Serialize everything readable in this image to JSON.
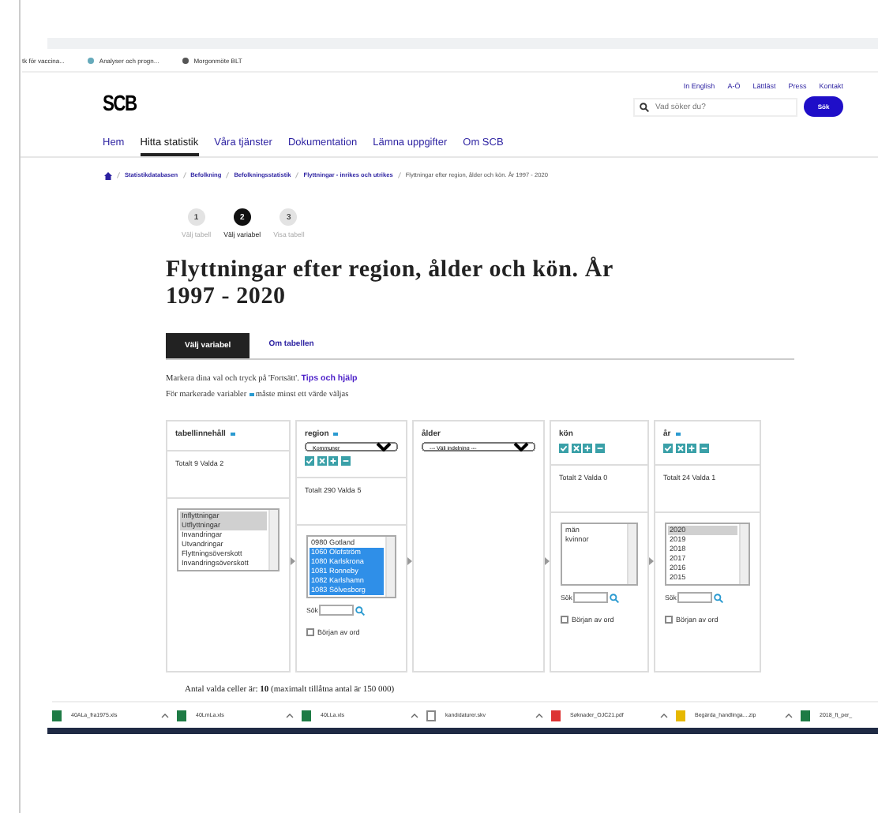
{
  "bookmarks": [
    "tk för vaccina...",
    "Analyser och progn...",
    "Morgonmöte BLT"
  ],
  "header": {
    "logo": "SCB",
    "top_links": [
      "In English",
      "A-Ö",
      "Lättläst",
      "Press",
      "Kontakt"
    ],
    "search": {
      "placeholder": "Vad söker du?"
    },
    "search_button": "Sök"
  },
  "nav": [
    {
      "label": "Hem",
      "selected": false
    },
    {
      "label": "Hitta statistik",
      "selected": true
    },
    {
      "label": "Våra tjänster",
      "selected": false
    },
    {
      "label": "Dokumentation",
      "selected": false
    },
    {
      "label": "Lämna uppgifter",
      "selected": false
    },
    {
      "label": "Om SCB",
      "selected": false
    }
  ],
  "breadcrumb": [
    "Statistikdatabasen",
    "Befolkning",
    "Befolkningsstatistik",
    "Flyttningar - inrikes och utrikes",
    "Flyttningar efter region, ålder och kön. År 1997 - 2020"
  ],
  "steps": [
    {
      "number": "1",
      "label": "Välj tabell",
      "selected": false
    },
    {
      "number": "2",
      "label": "Välj variabel",
      "selected": true
    },
    {
      "number": "3",
      "label": "Visa tabell",
      "selected": false
    }
  ],
  "title": "Flyttningar efter region, ålder och kön. År 1997 - 2020",
  "tabs": [
    {
      "label": "Välj variabel",
      "selected": true
    },
    {
      "label": "Om tabellen",
      "selected": false
    }
  ],
  "instructions": {
    "text": "Markera dina val och tryck på 'Fortsätt'.",
    "link": "Tips och hjälp",
    "note": "För markerade variabler",
    "note_end": "måste minst ett värde väljas"
  },
  "variables": [
    {
      "name": "tabellinnehåll",
      "mandatory": true,
      "totals": "Totalt 9 Valda 2",
      "items": [
        {
          "label": "Inflyttningar",
          "selected": true
        },
        {
          "label": "Utflyttningar",
          "selected": true
        },
        {
          "label": "Invandringar",
          "selected": false
        },
        {
          "label": "Utvandringar",
          "selected": false
        },
        {
          "label": "Flyttningsöverskott",
          "selected": false
        },
        {
          "label": "Invandringsöverskott",
          "selected": false
        }
      ]
    },
    {
      "name": "region",
      "mandatory": true,
      "select": "Kommuner",
      "tools": true,
      "totals": "Totalt 290 Valda 5",
      "items": [
        {
          "label": "0980 Gotland",
          "selected": false
        },
        {
          "label": "1060 Olofström",
          "selected": true
        },
        {
          "label": "1080 Karlskrona",
          "selected": true
        },
        {
          "label": "1081 Ronneby",
          "selected": true
        },
        {
          "label": "1082 Karlshamn",
          "selected": true
        },
        {
          "label": "1083 Sölvesborg",
          "selected": true
        }
      ],
      "search_label": "Sök",
      "word_start": {
        "label": "Början av ord",
        "checked": false
      }
    },
    {
      "name": "ålder",
      "mandatory": false,
      "select": "--- Välj indelning ---"
    },
    {
      "name": "kön",
      "mandatory": false,
      "tools": true,
      "totals": "Totalt 2 Valda 0",
      "items": [
        {
          "label": "män",
          "selected": false
        },
        {
          "label": "kvinnor",
          "selected": false
        }
      ],
      "search_label": "Sök",
      "word_start": {
        "label": "Början av ord",
        "checked": false
      }
    },
    {
      "name": "år",
      "mandatory": true,
      "tools": true,
      "totals": "Totalt 24 Valda 1",
      "items": [
        {
          "label": "2020",
          "selected": true
        },
        {
          "label": "2019",
          "selected": false
        },
        {
          "label": "2018",
          "selected": false
        },
        {
          "label": "2017",
          "selected": false
        },
        {
          "label": "2016",
          "selected": false
        },
        {
          "label": "2015",
          "selected": false
        }
      ],
      "search_label": "Sök",
      "word_start": {
        "label": "Början av ord",
        "checked": false
      }
    }
  ],
  "cell_count": "Antal valda celler är: **10** (maximalt tillåtna antal är 150 000)",
  "downloads": [
    {
      "name": "40ALa_fra1975.xls",
      "kind": "sheet"
    },
    {
      "name": "40LmLa.xls",
      "kind": "sheet"
    },
    {
      "name": "40LLa.xls",
      "kind": "sheet"
    },
    {
      "name": "kandidaturer.skv",
      "kind": "file"
    },
    {
      "name": "Søknader_OJC21.pdf",
      "kind": "pdf"
    },
    {
      "name": "Begärda_handlinga....zip",
      "kind": "zip"
    },
    {
      "name": "2018_ft_per_",
      "kind": "sheet"
    }
  ]
}
